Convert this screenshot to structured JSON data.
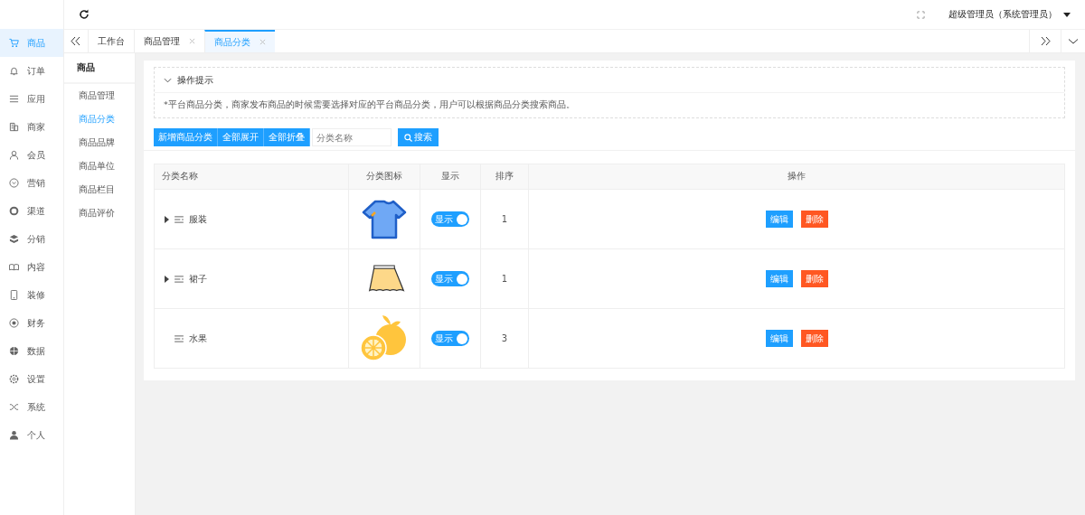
{
  "sidebar": {
    "items": [
      {
        "label": "商品",
        "selected": true
      },
      {
        "label": "订单",
        "selected": false
      },
      {
        "label": "应用",
        "selected": false
      },
      {
        "label": "商家",
        "selected": false
      },
      {
        "label": "会员",
        "selected": false
      },
      {
        "label": "营销",
        "selected": false
      },
      {
        "label": "渠道",
        "selected": false
      },
      {
        "label": "分销",
        "selected": false
      },
      {
        "label": "内容",
        "selected": false
      },
      {
        "label": "装修",
        "selected": false
      },
      {
        "label": "财务",
        "selected": false
      },
      {
        "label": "数据",
        "selected": false
      },
      {
        "label": "设置",
        "selected": false
      },
      {
        "label": "系统",
        "selected": false
      },
      {
        "label": "个人",
        "selected": false
      }
    ]
  },
  "header": {
    "user": "超级管理员（系统管理员）"
  },
  "tabs": [
    {
      "label": "工作台",
      "selected": false,
      "closable": false
    },
    {
      "label": "商品管理",
      "selected": false,
      "closable": true
    },
    {
      "label": "商品分类",
      "selected": true,
      "closable": true
    }
  ],
  "subnav": {
    "title": "商品",
    "items": [
      {
        "label": "商品管理",
        "selected": false
      },
      {
        "label": "商品分类",
        "selected": true
      },
      {
        "label": "商品品牌",
        "selected": false
      },
      {
        "label": "商品单位",
        "selected": false
      },
      {
        "label": "商品栏目",
        "selected": false
      },
      {
        "label": "商品评价",
        "selected": false
      }
    ]
  },
  "notice": {
    "title": "操作提示",
    "expanded": true,
    "text": "*平台商品分类，商家发布商品的时候需要选择对应的平台商品分类，用户可以根据商品分类搜索商品。"
  },
  "toolbar": {
    "buttons": [
      "新增商品分类",
      "全部展开",
      "全部折叠"
    ],
    "search": {
      "placeholder": "分类名称"
    },
    "search_button": "搜索"
  },
  "table": {
    "columns": [
      "分类名称",
      "分类图标",
      "显示",
      "排序",
      "操作"
    ],
    "rows": [
      {
        "name": "服装",
        "expandable": true,
        "show": {
          "label": "显示",
          "on": true
        },
        "sort": "1",
        "actions": [
          "编辑",
          "删除"
        ]
      },
      {
        "name": "裙子",
        "expandable": true,
        "show": {
          "label": "显示",
          "on": true
        },
        "sort": "1",
        "actions": [
          "编辑",
          "删除"
        ]
      },
      {
        "name": "水果",
        "expandable": false,
        "show": {
          "label": "显示",
          "on": true
        },
        "sort": "3",
        "actions": [
          "编辑",
          "删除"
        ]
      }
    ]
  }
}
